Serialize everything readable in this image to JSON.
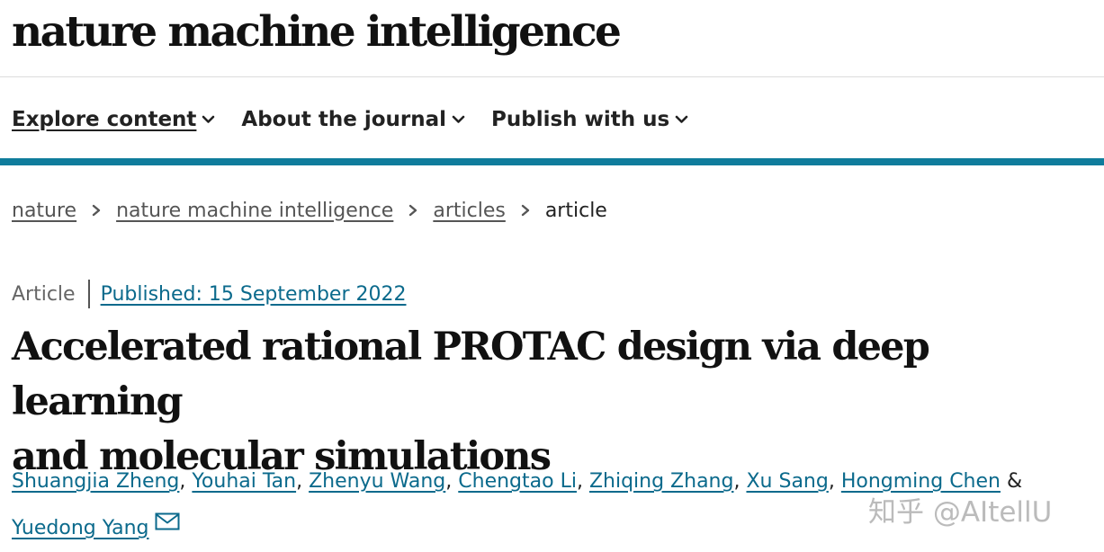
{
  "site": {
    "logo_text": "nature machine intelligence"
  },
  "nav": {
    "items": [
      {
        "label": "Explore content",
        "active": true
      },
      {
        "label": "About the journal",
        "active": false
      },
      {
        "label": "Publish with us",
        "active": false
      }
    ]
  },
  "breadcrumb": {
    "items": [
      "nature",
      "nature machine intelligence",
      "articles"
    ],
    "current": "article"
  },
  "article": {
    "type": "Article",
    "published": "Published: 15 September 2022",
    "title_line1": "Accelerated rational PROTAC design via deep learning",
    "title_line2": "and molecular simulations",
    "authors": [
      "Shuangjia Zheng",
      "Youhai Tan",
      "Zhenyu Wang",
      "Chengtao Li",
      "Zhiqing Zhang",
      "Xu Sang",
      "Hongming Chen",
      "Yuedong Yang"
    ],
    "author_separator": ", ",
    "last_author_joiner": " & "
  },
  "watermark": {
    "text": "知乎 @AItellU"
  },
  "colors": {
    "accent_teal": "#0f7c9c",
    "link": "#0b6a8c",
    "text": "#222222"
  },
  "icons": {
    "nav_chevron": "chevron-down-icon",
    "breadcrumb_separator": "chevron-right-icon",
    "corresponding_author": "mail-icon"
  }
}
